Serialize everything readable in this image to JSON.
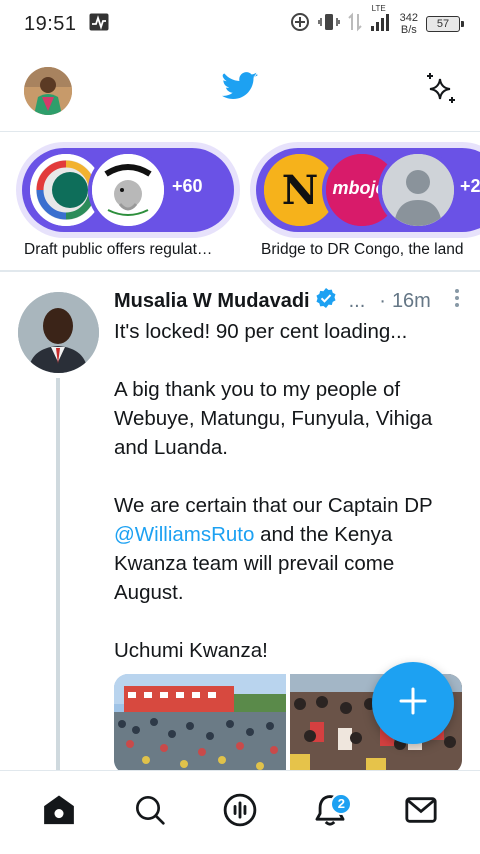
{
  "status_bar": {
    "time": "19:51",
    "network_type": "LTE",
    "net_speed_value": "342",
    "net_speed_unit": "B/s",
    "battery": "57"
  },
  "app_bar": {
    "logo_icon": "twitter-bird-icon",
    "accent_color": "#1da1f2"
  },
  "fleets": [
    {
      "label": "Draft public offers regulat…",
      "count": "+60"
    },
    {
      "label": "Bridge to DR Congo, the land",
      "count": "+2",
      "logo_text": "N",
      "logo2_text": "mbojet"
    }
  ],
  "tweet": {
    "author": "Musalia W Mudavadi",
    "handle": "...",
    "separator": "·",
    "time": "16m",
    "text_line1": "It's locked! 90 per cent loading...",
    "text_para2": "A big thank you to my people of Webuye, Matungu, Funyula, Vihiga and Luanda.",
    "text_para3_a": "We are certain that our Captain DP ",
    "mention": "@WilliamsRuto",
    "text_para3_b": " and the Kenya Kwanza team will prevail come August.",
    "text_para4": "Uchumi Kwanza!"
  },
  "bottom_nav": {
    "items": [
      "home-icon",
      "search-icon",
      "spaces-icon",
      "notifications-icon",
      "messages-icon"
    ],
    "notification_count": "2"
  }
}
